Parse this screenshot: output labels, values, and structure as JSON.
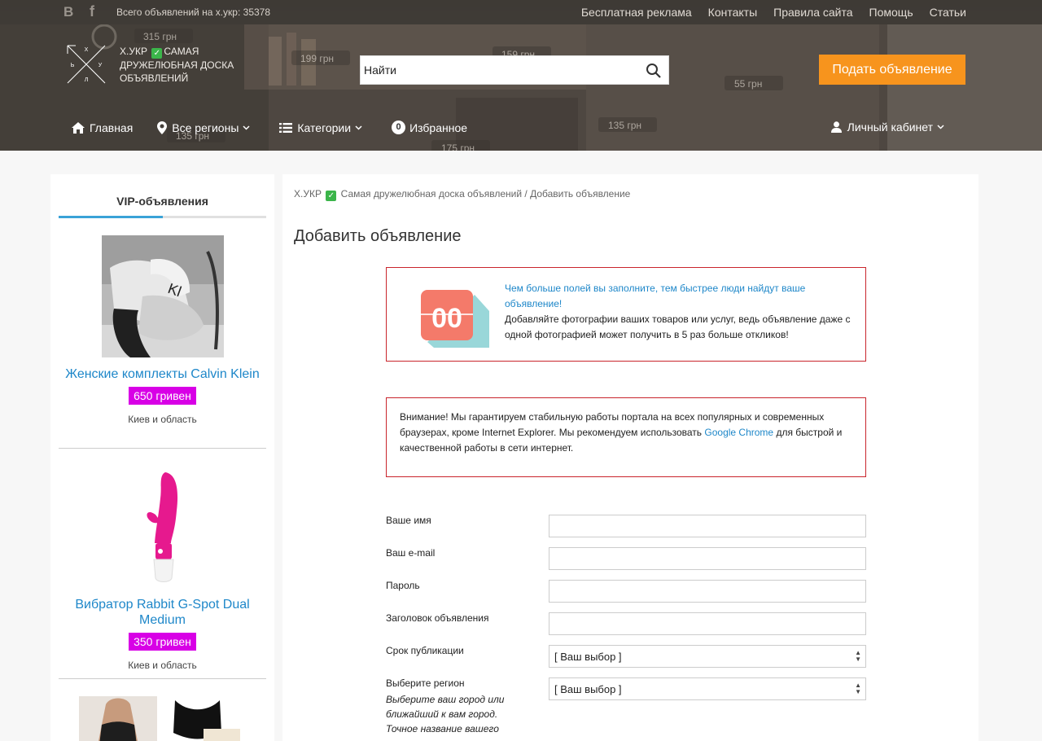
{
  "topbar": {
    "vk_icon": "vk-icon",
    "fb_icon": "facebook-icon",
    "ads_count": "Всего объявлений на х.укр: 35378",
    "links": [
      "Бесплатная реклама",
      "Контакты",
      "Правила сайта",
      "Помощь",
      "Статьи"
    ]
  },
  "logo": {
    "letters": [
      "Х",
      "Ь",
      "У",
      "Л"
    ],
    "text_before": "Х.УКР",
    "text_after": "САМАЯ ДРУЖЕЛЮБНАЯ ДОСКА ОБЪЯВЛЕНИЙ"
  },
  "search": {
    "placeholder": "Найти",
    "icon": "search-icon"
  },
  "post_button": "Подать объявление",
  "header_bg_prices": [
    "315 грн",
    "199 грн",
    "159 грн",
    "55 грн",
    "135 грн",
    "175 грн",
    "135 грн"
  ],
  "nav": {
    "home": "Главная",
    "regions": "Все регионы",
    "categories": "Категории",
    "fav_count": "0",
    "favorites": "Избранное",
    "cabinet": "Личный кабинет"
  },
  "sidebar": {
    "title": "VIP-объявления",
    "items": [
      {
        "title": "Женские комплекты Calvin Klein",
        "price": "650 гривен",
        "region": "Киев и область"
      },
      {
        "title": "Вибратор Rabbit G-Spot Dual Medium",
        "price": "350 гривен",
        "region": "Киев и область"
      }
    ]
  },
  "breadcrumb": {
    "site_before": "Х.УКР",
    "site_after": "Самая дружелюбная доска объявлений",
    "separator": "/",
    "current": "Добавить объявление"
  },
  "page_title": "Добавить объявление",
  "notice1": {
    "highlight": "Чем больше полей вы заполните, тем быстрее люди найдут ваше объявление!",
    "text": "Добавляйте фотографии ваших товаров или услуг, ведь объявление даже с одной фотографией может получить в 5 раз больше откликов!",
    "icon_text": "00"
  },
  "notice2": {
    "text_before": "Внимание! Мы гарантируем стабильную работы портала на всех популярных и современных браузерах, кроме Internet Explorer. Мы рекомендуем использовать ",
    "link": "Google Chrome",
    "text_after": " для быстрой и качественной работы в сети интернет."
  },
  "form": {
    "name_label": "Ваше имя",
    "email_label": "Ваш e-mail",
    "password_label": "Пароль",
    "ad_title_label": "Заголовок объявления",
    "term_label": "Срок публикации",
    "term_value": "[ Ваш выбор ]",
    "region_label": "Выберите регион",
    "region_hint": "Выберите ваш город или ближайший к вам город. Точное название вашего",
    "region_value": "[ Ваш выбор ]"
  }
}
